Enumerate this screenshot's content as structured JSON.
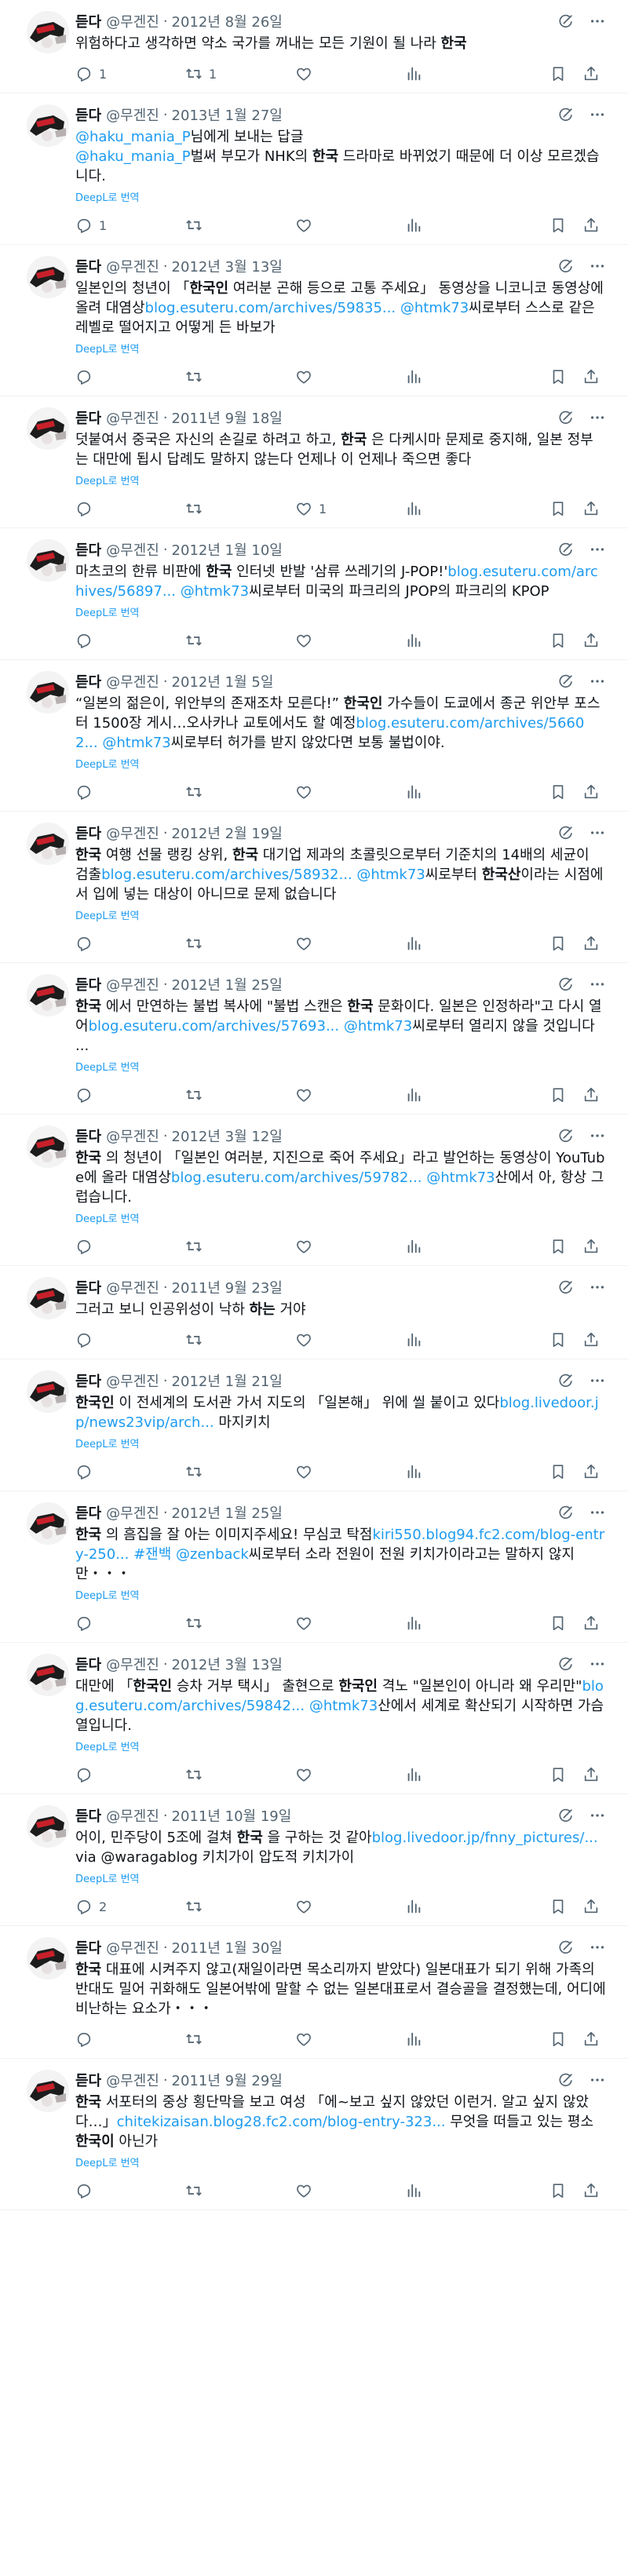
{
  "account": {
    "name": "듣다",
    "handle": "@무겐진"
  },
  "translate_label": "DeepL로 번역",
  "tweets": [
    {
      "date": "2012년 8월 26일",
      "show_translate": false,
      "segments": [
        [
          "t",
          "위험하다고 생각하면 약소 국가를 꺼내는 모든 기원이 될 나라 "
        ],
        [
          "h",
          "한국"
        ]
      ],
      "counts": {
        "reply": "1",
        "retweet": "1",
        "like": "",
        "views": ""
      }
    },
    {
      "date": "2013년 1월 27일",
      "show_translate": true,
      "segments": [
        [
          "l",
          "@haku_mania_P"
        ],
        [
          "t",
          "님에게 보내는 답글"
        ],
        [
          "br",
          ""
        ],
        [
          "l",
          "@haku_mania_P"
        ],
        [
          "t",
          "벌써 부모가 NHK의 "
        ],
        [
          "h",
          "한국"
        ],
        [
          "t",
          " 드라마로 바뀌었기 때문에 더 이상 모르겠습니다."
        ]
      ],
      "counts": {
        "reply": "1",
        "retweet": "",
        "like": "",
        "views": ""
      }
    },
    {
      "date": "2012년 3월 13일",
      "show_translate": true,
      "segments": [
        [
          "t",
          "일본인의 청년이 「"
        ],
        [
          "h",
          "한국인"
        ],
        [
          "t",
          " 여러분 곤해 등으로 고통 주세요」 동영상을 니코니코 동영상에 올려 대염상"
        ],
        [
          "l",
          "blog.esuteru.com/archives/59835..."
        ],
        [
          "t",
          " "
        ],
        [
          "l",
          "@htmk73"
        ],
        [
          "t",
          "씨로부터 스스로 같은 레벨로 떨어지고 어떻게 든 바보가"
        ]
      ],
      "counts": {
        "reply": "",
        "retweet": "",
        "like": "",
        "views": ""
      }
    },
    {
      "date": "2011년 9월 18일",
      "show_translate": true,
      "segments": [
        [
          "t",
          "덧붙여서 중국은 자신의 손길로 하려고 하고, "
        ],
        [
          "h",
          "한국"
        ],
        [
          "t",
          " 은 다케시마 문제로 중지해, 일본 정부는 대만에 됩시 답례도 말하지 않는다 언제나 이 언제나 죽으면 좋다"
        ]
      ],
      "counts": {
        "reply": "",
        "retweet": "",
        "like": "1",
        "views": ""
      }
    },
    {
      "date": "2012년 1월 10일",
      "show_translate": true,
      "segments": [
        [
          "t",
          "마츠코의 한류 비판에 "
        ],
        [
          "h",
          "한국"
        ],
        [
          "t",
          " 인터넷 반발 '삼류 쓰레기의 J-POP!'"
        ],
        [
          "l",
          "blog.esuteru.com/archives/56897..."
        ],
        [
          "t",
          " "
        ],
        [
          "l",
          "@htmk73"
        ],
        [
          "t",
          "씨로부터 미국의 파크리의 JPOP의 파크리의 KPOP"
        ]
      ],
      "counts": {
        "reply": "",
        "retweet": "",
        "like": "",
        "views": ""
      }
    },
    {
      "date": "2012년 1월 5일",
      "show_translate": true,
      "segments": [
        [
          "t",
          "“일본의 젊은이, 위안부의 존재조차 모른다!” "
        ],
        [
          "h",
          "한국인"
        ],
        [
          "t",
          " 가수들이 도쿄에서 종군 위안부 포스터 1500장 게시…오사카나 교토에서도 할 예정"
        ],
        [
          "l",
          "blog.esuteru.com/archives/56602..."
        ],
        [
          "t",
          " "
        ],
        [
          "l",
          "@htmk73"
        ],
        [
          "t",
          "씨로부터 허가를 받지 않았다면 보통 불법이야."
        ]
      ],
      "counts": {
        "reply": "",
        "retweet": "",
        "like": "",
        "views": ""
      }
    },
    {
      "date": "2012년 2월 19일",
      "show_translate": true,
      "segments": [
        [
          "h",
          "한국"
        ],
        [
          "t",
          " 여행 선물 랭킹 상위, "
        ],
        [
          "h",
          "한국"
        ],
        [
          "t",
          " 대기업 제과의 초콜릿으로부터 기준치의 14배의 세균이 검출"
        ],
        [
          "l",
          "blog.esuteru.com/archives/58932..."
        ],
        [
          "t",
          " "
        ],
        [
          "l",
          "@htmk73"
        ],
        [
          "t",
          "씨로부터 "
        ],
        [
          "h",
          "한국산"
        ],
        [
          "t",
          "이라는 시점에서 입에 넣는 대상이 아니므로 문제 없습니다"
        ]
      ],
      "counts": {
        "reply": "",
        "retweet": "",
        "like": "",
        "views": ""
      }
    },
    {
      "date": "2012년 1월 25일",
      "show_translate": true,
      "segments": [
        [
          "h",
          "한국"
        ],
        [
          "t",
          " 에서 만연하는 불법 복사에 \"불법 스캔은 "
        ],
        [
          "h",
          "한국"
        ],
        [
          "t",
          " 문화이다. 일본은 인정하라\"고 다시 열어"
        ],
        [
          "l",
          "blog.esuteru.com/archives/57693..."
        ],
        [
          "t",
          " "
        ],
        [
          "l",
          "@htmk73"
        ],
        [
          "t",
          "씨로부터 열리지 않을 것입니다 ..."
        ]
      ],
      "counts": {
        "reply": "",
        "retweet": "",
        "like": "",
        "views": ""
      }
    },
    {
      "date": "2012년 3월 12일",
      "show_translate": true,
      "segments": [
        [
          "h",
          "한국"
        ],
        [
          "t",
          " 의 청년이 「일본인 여러분, 지진으로 죽어 주세요」라고 발언하는 동영상이 YouTube에 올라 대염상"
        ],
        [
          "l",
          "blog.esuteru.com/archives/59782..."
        ],
        [
          "t",
          " "
        ],
        [
          "l",
          "@htmk73"
        ],
        [
          "t",
          "산에서 아, 항상 그럽습니다."
        ]
      ],
      "counts": {
        "reply": "",
        "retweet": "",
        "like": "",
        "views": ""
      }
    },
    {
      "date": "2011년 9월 23일",
      "show_translate": false,
      "segments": [
        [
          "t",
          "그러고 보니 인공위성이 낙하 "
        ],
        [
          "h",
          "하는"
        ],
        [
          "t",
          " 거야"
        ]
      ],
      "counts": {
        "reply": "",
        "retweet": "",
        "like": "",
        "views": ""
      }
    },
    {
      "date": "2012년 1월 21일",
      "show_translate": true,
      "segments": [
        [
          "h",
          "한국인"
        ],
        [
          "t",
          " 이 전세계의 도서관 가서 지도의 「일본해」 위에 씰 붙이고 있다"
        ],
        [
          "l",
          "blog.livedoor.jp/news23vip/arch..."
        ],
        [
          "t",
          " 마지키치"
        ]
      ],
      "counts": {
        "reply": "",
        "retweet": "",
        "like": "",
        "views": ""
      }
    },
    {
      "date": "2012년 1월 25일",
      "show_translate": true,
      "segments": [
        [
          "h",
          "한국"
        ],
        [
          "t",
          " 의 흠집을 잘 아는 이미지주세요! 무심코 탁점"
        ],
        [
          "l",
          "kiri550.blog94.fc2.com/blog-entry-250..."
        ],
        [
          "t",
          " "
        ],
        [
          "l",
          "#잰백"
        ],
        [
          "t",
          " "
        ],
        [
          "l",
          "@zenback"
        ],
        [
          "t",
          "씨로부터 소라 전원이 전원 키치가이라고는 말하지 않지만・・・"
        ]
      ],
      "counts": {
        "reply": "",
        "retweet": "",
        "like": "",
        "views": ""
      }
    },
    {
      "date": "2012년 3월 13일",
      "show_translate": true,
      "segments": [
        [
          "t",
          "대만에 「"
        ],
        [
          "h",
          "한국인"
        ],
        [
          "t",
          " 승차 거부 택시」 출현으로 "
        ],
        [
          "h",
          "한국인"
        ],
        [
          "t",
          " 격노 \"일본인이 아니라 왜 우리만\""
        ],
        [
          "l",
          "blog.esuteru.com/archives/59842..."
        ],
        [
          "t",
          " "
        ],
        [
          "l",
          "@htmk73"
        ],
        [
          "t",
          "산에서 세계로 확산되기 시작하면 가슴 열입니다."
        ]
      ],
      "counts": {
        "reply": "",
        "retweet": "",
        "like": "",
        "views": ""
      }
    },
    {
      "date": "2011년 10월 19일",
      "show_translate": true,
      "segments": [
        [
          "t",
          "어이, 민주당이 5조에 걸쳐 "
        ],
        [
          "h",
          "한국"
        ],
        [
          "t",
          " 을 구하는 것 같아"
        ],
        [
          "l",
          "blog.livedoor.jp/fnny_pictures/..."
        ],
        [
          "t",
          " via @waragablog 키치가이 압도적 키치가이"
        ]
      ],
      "counts": {
        "reply": "2",
        "retweet": "",
        "like": "",
        "views": ""
      }
    },
    {
      "date": "2011년 1월 30일",
      "show_translate": false,
      "segments": [
        [
          "h",
          "한국"
        ],
        [
          "t",
          " 대표에 시켜주지 않고(재일이라면 목소리까지 받았다) 일본대표가 되기 위해 가족의 반대도 밀어 귀화해도 일본어밖에 말할 수 없는 일본대표로서 결승골을 결정했는데, 어디에 비난하는 요소가・・・"
        ]
      ],
      "counts": {
        "reply": "",
        "retweet": "",
        "like": "",
        "views": ""
      }
    },
    {
      "date": "2011년 9월 29일",
      "show_translate": true,
      "segments": [
        [
          "h",
          "한국"
        ],
        [
          "t",
          " 서포터의 중상 횡단막을 보고 여성 「에~보고 싶지 않았던 이런거. 알고 싶지 않았다…」"
        ],
        [
          "l",
          "chitekizaisan.blog28.fc2.com/blog-entry-323..."
        ],
        [
          "t",
          " 무엇을 떠들고 있는 평소 "
        ],
        [
          "h",
          "한국이"
        ],
        [
          "t",
          " 아닌가"
        ]
      ],
      "counts": {
        "reply": "",
        "retweet": "",
        "like": "",
        "views": ""
      }
    }
  ]
}
